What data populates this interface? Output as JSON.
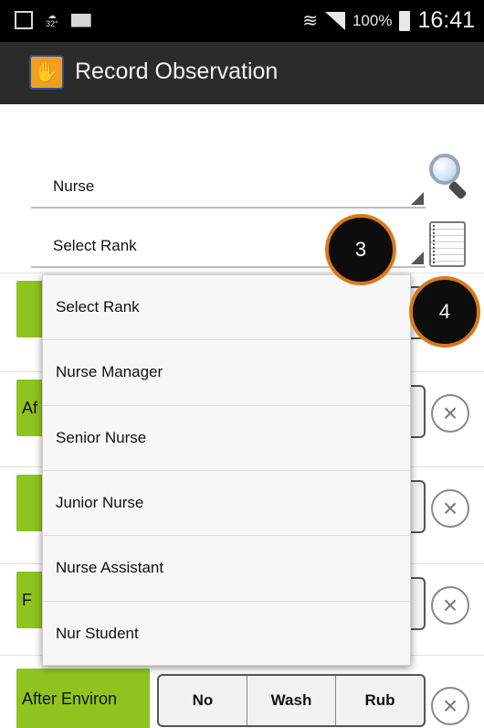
{
  "status_bar": {
    "temperature": "32°",
    "battery_percent": "100%",
    "time": "16:41",
    "icons": [
      "gallery-icon",
      "weather-icon",
      "mail-icon",
      "wifi-icon",
      "signal-icon",
      "battery-icon"
    ]
  },
  "action_bar": {
    "title": "Record Observation",
    "app_icon": "hand-wash-icon"
  },
  "form": {
    "role_value": "Nurse",
    "rank_value": "Select Rank"
  },
  "annotations": {
    "badge_3": "3",
    "badge_4": "4"
  },
  "rows": [
    {
      "label": "",
      "options": [
        "",
        "",
        ""
      ]
    },
    {
      "label": "Af",
      "options": [
        "",
        "",
        ""
      ]
    },
    {
      "label": "",
      "options": [
        "",
        "",
        ""
      ]
    },
    {
      "label": "F",
      "options": [
        "",
        "",
        ""
      ]
    },
    {
      "label": "",
      "options": [
        "",
        "",
        ""
      ]
    },
    {
      "label": "After Environ",
      "options": [
        "No",
        "Wash",
        "Rub"
      ]
    }
  ],
  "dropdown": {
    "items": [
      "Select Rank",
      "Nurse Manager",
      "Senior Nurse",
      "Junior Nurse",
      "Nurse Assistant",
      "Nur Student"
    ]
  },
  "colors": {
    "accent_green": "#8fc31f",
    "badge_ring": "#d9781c",
    "action_bar": "#2b2b2b"
  }
}
